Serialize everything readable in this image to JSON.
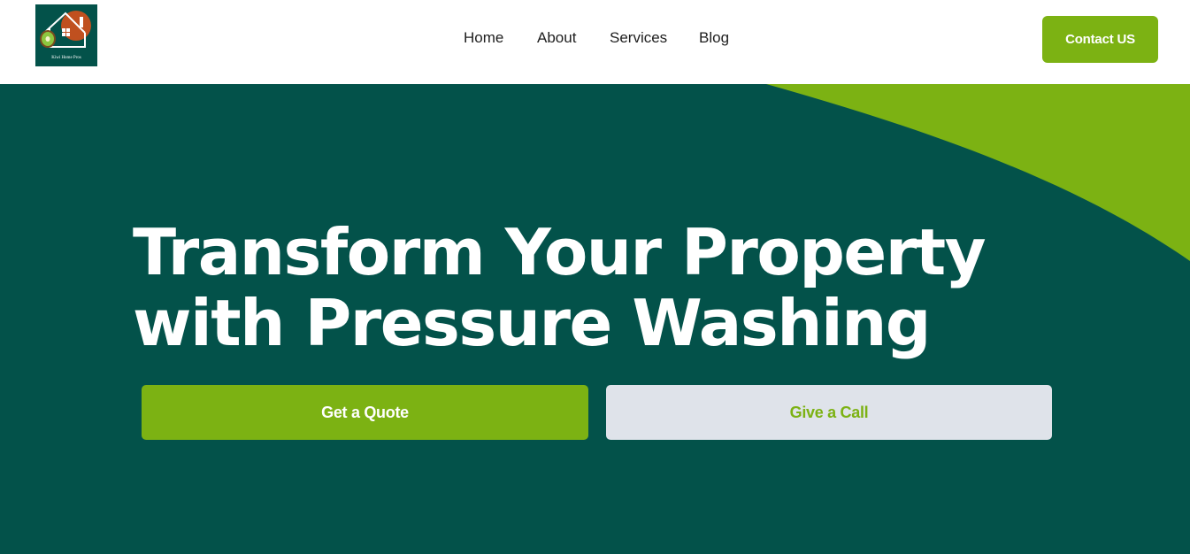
{
  "header": {
    "logo_text": "Kiwi Home Pros",
    "nav": [
      {
        "label": "Home"
      },
      {
        "label": "About"
      },
      {
        "label": "Services"
      },
      {
        "label": "Blog"
      }
    ],
    "contact_label": "Contact US"
  },
  "hero": {
    "title_line1": "Transform Your Property",
    "title_line2": "with Pressure Washing",
    "quote_label": "Get a Quote",
    "call_label": "Give a Call"
  },
  "colors": {
    "brand_green": "#7cb213",
    "dark_teal": "#03524a",
    "button_light": "#dfe3ea"
  },
  "icons": {
    "logo": "house-kiwi-logo-icon"
  }
}
